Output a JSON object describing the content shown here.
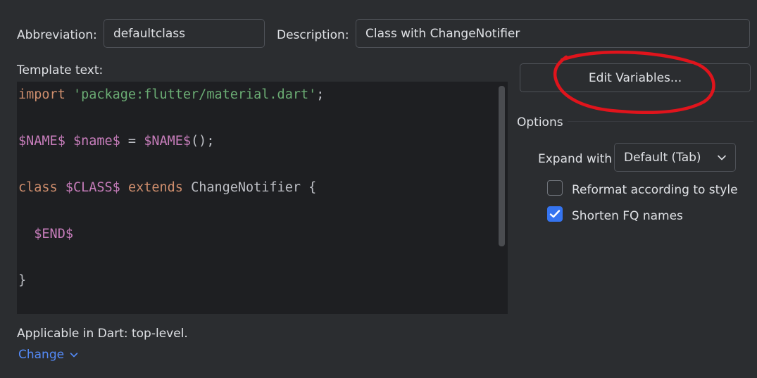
{
  "abbreviation": {
    "label": "Abbreviation:",
    "value": "defaultclass"
  },
  "description": {
    "label": "Description:",
    "value": "Class with ChangeNotifier"
  },
  "template": {
    "label": "Template text:",
    "lines": {
      "l1": {
        "kw": "import",
        "str": "'package:flutter/material.dart'",
        "end": ";"
      },
      "l2": {
        "v1": "$NAME$",
        "v2": "$name$",
        "eq": " = ",
        "v3": "$NAME$",
        "end": "();"
      },
      "l3": {
        "kw1": "class",
        "v1": "$CLASS$",
        "kw2": "extends",
        "cls": "ChangeNotifier",
        "end": " {"
      },
      "l4": {
        "v1": "$END$"
      },
      "l5": {
        "text": "}"
      }
    }
  },
  "edit_variables_label": "Edit Variables...",
  "options": {
    "title": "Options",
    "expand_with_label": "Expand with",
    "expand_with_value": "Default (Tab)",
    "reformat": {
      "label": "Reformat according to style",
      "checked": false
    },
    "shorten": {
      "label": "Shorten FQ names",
      "checked": true
    }
  },
  "applicable": "Applicable in Dart: top-level.",
  "change_link": "Change",
  "annotation_color": "#e0141c",
  "icons": {
    "dropdown": "chevron-down-icon",
    "check": "check-icon",
    "change": "chevron-down-icon"
  }
}
